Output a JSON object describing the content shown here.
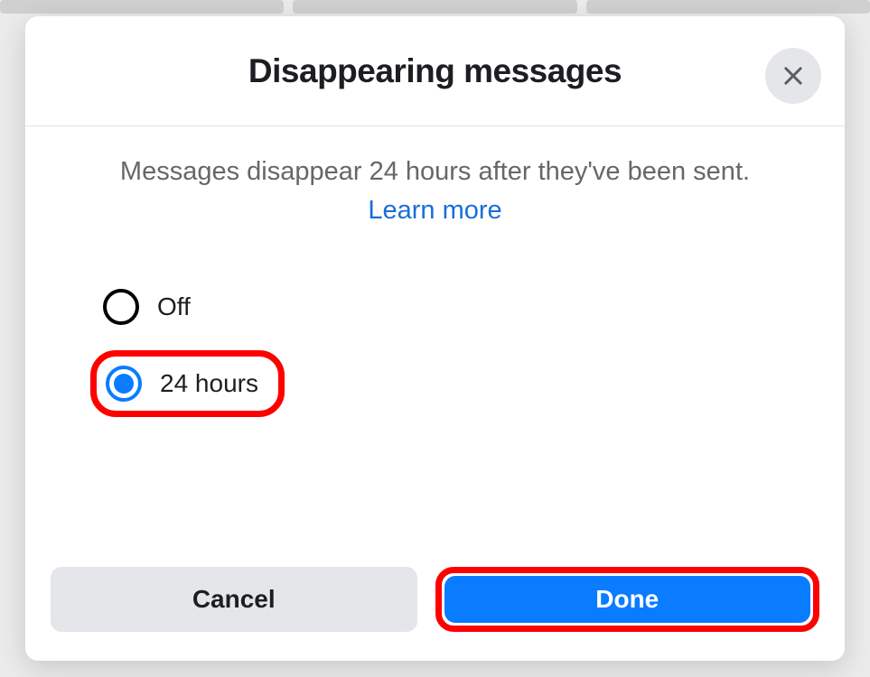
{
  "modal": {
    "title": "Disappearing messages",
    "description": "Messages disappear 24 hours after they've been sent.",
    "learn_more_label": "Learn more"
  },
  "options": {
    "off": {
      "label": "Off",
      "selected": false
    },
    "twenty_four_hours": {
      "label": "24 hours",
      "selected": true
    }
  },
  "footer": {
    "cancel_label": "Cancel",
    "done_label": "Done"
  },
  "colors": {
    "accent": "#0a7cff",
    "highlight_ring": "#ff0000",
    "link": "#1a6ed8",
    "muted": "#65676b"
  }
}
